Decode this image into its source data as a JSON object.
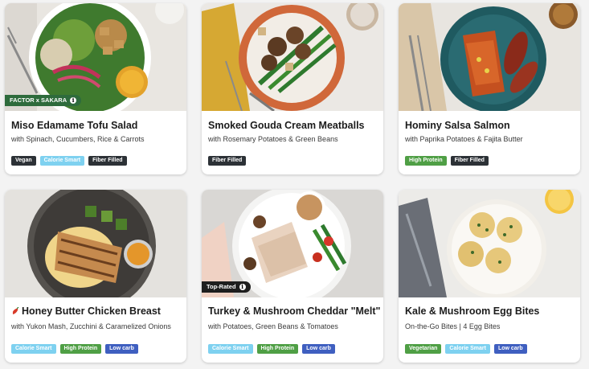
{
  "colors": {
    "vegan": "#2c3136",
    "calorie_smart": "#7ed1f0",
    "fiber_filled": "#2c3136",
    "high_protein": "#4f9f45",
    "low_carb": "#3f5fc0",
    "vegetarian": "#4f9f45",
    "factor_badge": "#2e6b3c",
    "top_rated_badge": "#1e1e1e",
    "chili": "#d83b2a"
  },
  "meals": [
    {
      "title": "Miso Edamame Tofu Salad",
      "subtitle": "with Spinach, Cucumbers, Rice & Carrots",
      "badge": "FACTOR x SAKARA",
      "tags": [
        "Vegan",
        "Calorie Smart",
        "Fiber Filled"
      ]
    },
    {
      "title": "Smoked Gouda Cream Meatballs",
      "subtitle": "with Rosemary Potatoes & Green Beans",
      "tags": [
        "Fiber Filled"
      ]
    },
    {
      "title": "Hominy Salsa Salmon",
      "subtitle": "with Paprika Potatoes & Fajita Butter",
      "tags": [
        "High Protein",
        "Fiber Filled"
      ]
    },
    {
      "title": "Honey Butter Chicken Breast",
      "subtitle": "with Yukon Mash, Zucchini & Caramelized Onions",
      "tags": [
        "Calorie Smart",
        "High Protein",
        "Low carb"
      ]
    },
    {
      "title": "Turkey & Mushroom Cheddar \"Melt\"",
      "subtitle": "with Potatoes, Green Beans & Tomatoes",
      "badge": "Top-Rated",
      "tags": [
        "Calorie Smart",
        "High Protein",
        "Low carb"
      ]
    },
    {
      "title": "Kale & Mushroom Egg Bites",
      "subtitle": "On-the-Go Bites | 4 Egg Bites",
      "tags": [
        "Vegetarian",
        "Calorie Smart",
        "Low carb"
      ]
    }
  ]
}
